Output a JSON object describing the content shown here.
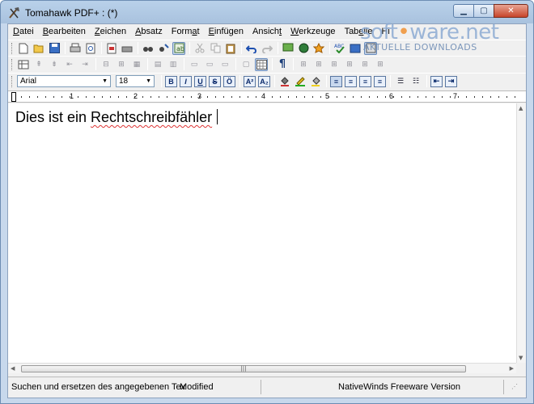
{
  "window": {
    "title": "Tomahawk PDF+ : (*)",
    "controls": {
      "minimize": "▁",
      "maximize": "▢",
      "close": "✕"
    }
  },
  "watermark": {
    "brand_pre": "soft",
    "brand_dot": "•",
    "brand_post": "ware.net",
    "sub": "AKTUELLE DOWNLOADS"
  },
  "menubar": {
    "items": [
      {
        "u": "D",
        "rest": "atei"
      },
      {
        "u": "B",
        "rest": "earbeiten"
      },
      {
        "u": "Z",
        "rest": "eichen"
      },
      {
        "u": "A",
        "rest": "bsatz"
      },
      {
        "pre": "Form",
        "u": "a",
        "rest": "t"
      },
      {
        "u": "E",
        "rest": "infügen"
      },
      {
        "pre": "Ansich",
        "u": "t",
        "rest": ""
      },
      {
        "u": "W",
        "rest": "erkzeuge"
      },
      {
        "pre": "Tab",
        "u": "e",
        "rest": "lle"
      },
      {
        "pre": "Hi",
        "u": "",
        "rest": ""
      }
    ]
  },
  "format_toolbar": {
    "font_name": "Arial",
    "font_size": "18",
    "bold": "B",
    "italic": "I",
    "underline": "U",
    "strikethrough": "S"
  },
  "ruler": {
    "numbers": [
      "1",
      "2",
      "3",
      "4",
      "5",
      "6",
      "7"
    ]
  },
  "document": {
    "text_before": "Dies ist ein ",
    "misspelled_word": "Rechtschreibfähler"
  },
  "statusbar": {
    "hint": "Suchen und ersetzen des angegebenen Textes i",
    "state": "Modified",
    "info": "NativeWinds Freeware Version"
  },
  "colors": {
    "accent": "#6d8db3",
    "spell_error": "#d33"
  }
}
